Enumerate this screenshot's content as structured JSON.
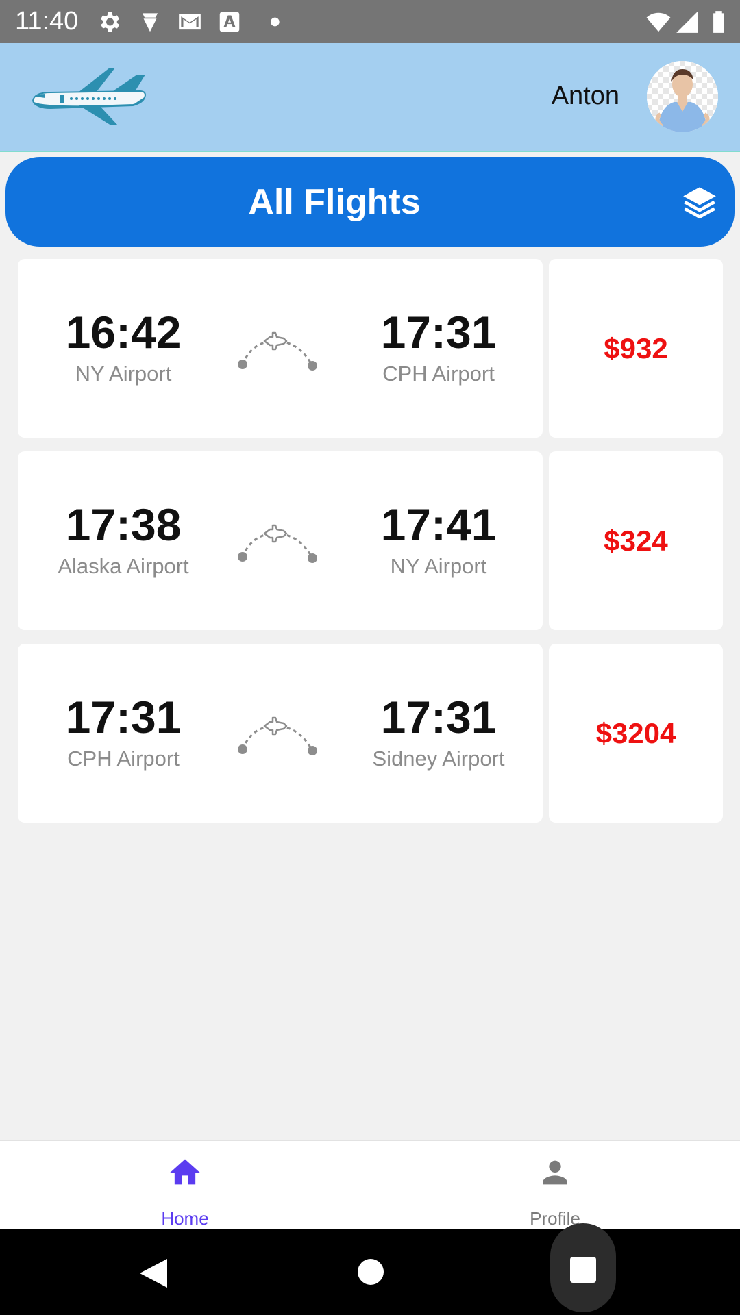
{
  "status_bar": {
    "time": "11:40",
    "icons": [
      "gear-icon",
      "diamond-icon",
      "gmail-icon",
      "font-a-icon",
      "dot-icon",
      "wifi-icon",
      "signal-icon",
      "battery-icon"
    ]
  },
  "header": {
    "logo_icon": "airplane-logo",
    "user_name": "Anton",
    "avatar_icon": "user-avatar"
  },
  "banner": {
    "title": "All Flights",
    "icon": "layers-icon",
    "color": "#1173dd"
  },
  "flights": [
    {
      "dep_time": "16:42",
      "dep_airport": "NY Airport",
      "arr_time": "17:31",
      "arr_airport": "CPH Airport",
      "price": "$932"
    },
    {
      "dep_time": "17:38",
      "dep_airport": "Alaska Airport",
      "arr_time": "17:41",
      "arr_airport": "NY Airport",
      "price": "$324"
    },
    {
      "dep_time": "17:31",
      "dep_airport": "CPH Airport",
      "arr_time": "17:31",
      "arr_airport": "Sidney Airport",
      "price": "$3204"
    }
  ],
  "bottom_nav": {
    "items": [
      {
        "label": "Home",
        "icon": "home-icon",
        "active": true,
        "color": "#5b3cf0"
      },
      {
        "label": "Profile",
        "icon": "person-icon",
        "active": false,
        "color": "#7a7a7a"
      }
    ]
  },
  "colors": {
    "price": "#ee1111",
    "header_bg": "#a4cff0",
    "accent": "#5b3cf0"
  }
}
